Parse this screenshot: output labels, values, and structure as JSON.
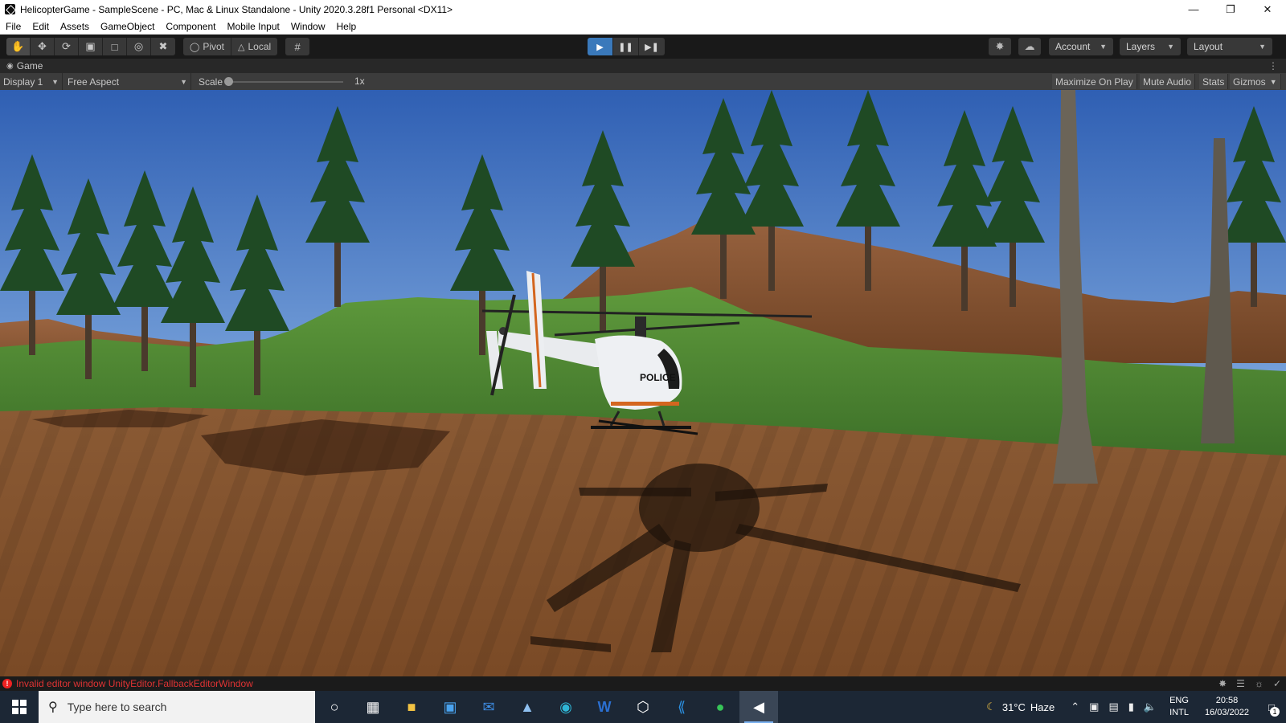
{
  "window": {
    "title": "HelicopterGame - SampleScene - PC, Mac & Linux Standalone - Unity 2020.3.28f1 Personal <DX11>"
  },
  "menu": [
    "File",
    "Edit",
    "Assets",
    "GameObject",
    "Component",
    "Mobile Input",
    "Window",
    "Help"
  ],
  "toolbar": {
    "pivot_label": "Pivot",
    "local_label": "Local",
    "account_label": "Account",
    "layers_label": "Layers",
    "layout_label": "Layout",
    "play_state": "playing"
  },
  "game_view": {
    "tab_label": "Game",
    "display": "Display 1",
    "aspect": "Free Aspect",
    "scale_label": "Scale",
    "scale_value": "1x",
    "maximize_on_play": "Maximize On Play",
    "mute_audio": "Mute Audio",
    "stats": "Stats",
    "gizmos": "Gizmos"
  },
  "scene": {
    "helicopter_text": "POLICE"
  },
  "status": {
    "error_message": "Invalid editor window UnityEditor.FallbackEditorWindow"
  },
  "taskbar": {
    "search_placeholder": "Type here to search",
    "weather_temp": "31°C",
    "weather_text": "Haze",
    "lang_line1": "ENG",
    "lang_line2": "INTL",
    "time": "20:58",
    "date": "16/03/2022",
    "notification_count": "1"
  },
  "colors": {
    "play_active": "#3a79bb",
    "error": "#dd3333",
    "taskbar": "#1c2735"
  }
}
